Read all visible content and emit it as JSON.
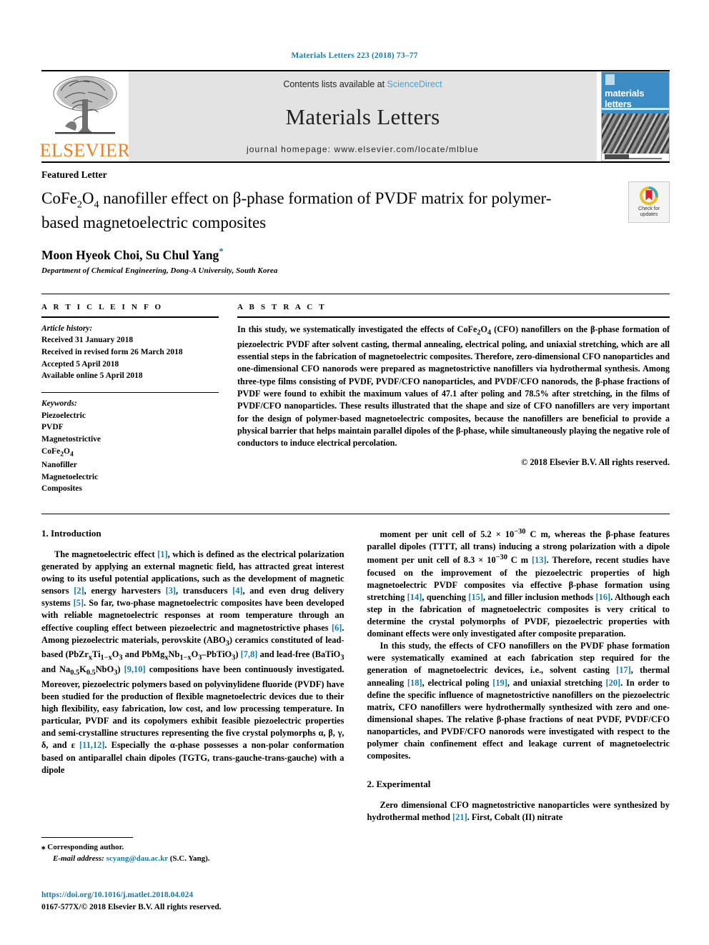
{
  "running_head": "Materials Letters 223 (2018) 73–77",
  "masthead": {
    "publisher_name": "ELSEVIER",
    "contents_prefix": "Contents lists available at ",
    "contents_link": "ScienceDirect",
    "journal_title": "Materials Letters",
    "homepage": "journal homepage: www.elsevier.com/locate/mlblue",
    "cover_title": "materials letters",
    "link_color": "#3aa6d8",
    "brand_color": "#ef7d22"
  },
  "article": {
    "type_label": "Featured Letter",
    "title_html": "CoFe<sub>2</sub>O<sub>4</sub> nanofiller effect on β-phase formation of PVDF matrix for polymer-based magnetoelectric composites",
    "title_plain": "CoFe2O4 nanofiller effect on β-phase formation of PVDF matrix for polymer-based magnetoelectric composites",
    "authors": "Moon Hyeok Choi, Su Chul Yang",
    "corresponding_marker": "*",
    "affiliation": "Department of Chemical Engineering, Dong-A University, South Korea",
    "crossmark_line1": "Check for",
    "crossmark_line2": "updates"
  },
  "article_info": {
    "heading": "A R T I C L E  I N F O",
    "history_label": "Article history:",
    "history": [
      "Received 31 January 2018",
      "Received in revised form 26 March 2018",
      "Accepted 5 April 2018",
      "Available online 5 April 2018"
    ],
    "keywords_label": "Keywords:",
    "keywords": [
      "Piezoelectric",
      "PVDF",
      "Magnetostrictive",
      "CoFe2O4",
      "Nanofiller",
      "Magnetoelectric",
      "Composites"
    ]
  },
  "abstract": {
    "heading": "A B S T R A C T",
    "text_html": "In this study, we systematically investigated the effects of CoFe<sub>2</sub>O<sub>4</sub> (CFO) nanofillers on the β-phase formation of piezoelectric PVDF after solvent casting, thermal annealing, electrical poling, and uniaxial stretching, which are all essential steps in the fabrication of magnetoelectric composites. Therefore, zero-dimensional CFO nanoparticles and one-dimensional CFO nanorods were prepared as magnetostrictive nanofillers via hydrothermal synthesis. Among three-type films consisting of PVDF, PVDF/CFO nanoparticles, and PVDF/CFO nanorods, the β-phase fractions of PVDF were found to exhibit the maximum values of 47.1 after poling and 78.5% after stretching, in the films of PVDF/CFO nanoparticles. These results illustrated that the shape and size of CFO nanofillers are very important for the design of polymer-based magnetoelectric composites, because the nanofillers are beneficial to provide a physical barrier that helps maintain parallel dipoles of the β-phase, while simultaneously playing the negative role of conductors to induce electrical percolation.",
    "copyright": "© 2018 Elsevier B.V. All rights reserved."
  },
  "sections": {
    "introduction_heading": "1. Introduction",
    "experimental_heading": "2. Experimental",
    "intro_p1_html": "The magnetoelectric effect <span class=\"ref\">[1]</span>, which is defined as the electrical polarization generated by applying an external magnetic field, has attracted great interest owing to its useful potential applications, such as the development of magnetic sensors <span class=\"ref\">[2]</span>, energy harvesters <span class=\"ref\">[3]</span>, transducers <span class=\"ref\">[4]</span>, and even drug delivery systems <span class=\"ref\">[5]</span>. So far, two-phase magnetoelectric composites have been developed with reliable magnetoelectric responses at room temperature through an effective coupling effect between piezoelectric and magnetostrictive phases <span class=\"ref\">[6]</span>. Among piezoelectric materials, perovskite (ABO<sub>3</sub>) ceramics constituted of lead-based (PbZr<sub>x</sub>Ti<sub>1−x</sub>O<sub>3</sub> and PbMg<sub>x</sub>Nb<sub>1−x</sub>O<sub>3</sub>–PbTiO<sub>3</sub>) <span class=\"ref\">[7,8]</span> and lead-free (BaTiO<sub>3</sub> and Na<sub>0.5</sub>K<sub>0.5</sub>NbO<sub>3</sub>) <span class=\"ref\">[9,10]</span> compositions have been continuously investigated. Moreover, piezoelectric polymers based on polyvinylidene fluoride (PVDF) have been studied for the production of flexible magnetoelectric devices due to their high flexibility, easy fabrication, low cost, and low processing temperature. In particular, PVDF and its copolymers exhibit feasible piezoelectric properties and semi-crystalline structures representing the five crystal polymorphs α, β, γ, δ, and ε <span class=\"ref\">[11,12]</span>. Especially the α-phase possesses a non-polar conformation based on antiparallel chain dipoles (TGTG, trans-gauche-trans-gauche) with a dipole",
    "intro_p2_html": "moment per unit cell of 5.2 × 10<sup>−30</sup> C m, whereas the β-phase features parallel dipoles (TTTT, all trans) inducing a strong polarization with a dipole moment per unit cell of 8.3 × 10<sup>−30</sup> C m <span class=\"ref\">[13]</span>. Therefore, recent studies have focused on the improvement of the piezoelectric properties of high magnetoelectric PVDF composites via effective β-phase formation using stretching <span class=\"ref\">[14]</span>, quenching <span class=\"ref\">[15]</span>, and filler inclusion methods <span class=\"ref\">[16]</span>. Although each step in the fabrication of magnetoelectric composites is very critical to determine the crystal polymorphs of PVDF, piezoelectric properties with dominant effects were only investigated after composite preparation.",
    "intro_p3_html": "In this study, the effects of CFO nanofillers on the PVDF phase formation were systematically examined at each fabrication step required for the generation of magnetoelectric devices, i.e., solvent casting <span class=\"ref\">[17]</span>, thermal annealing <span class=\"ref\">[18]</span>, electrical poling <span class=\"ref\">[19]</span>, and uniaxial stretching <span class=\"ref\">[20]</span>. In order to define the specific influence of magnetostrictive nanofillers on the piezoelectric matrix, CFO nanofillers were hydrothermally synthesized with zero and one-dimensional shapes. The relative β-phase fractions of neat PVDF, PVDF/CFO nanoparticles, and PVDF/CFO nanorods were investigated with respect to the polymer chain confinement effect and leakage current of magnetoelectric composites.",
    "experimental_p1_html": "Zero dimensional CFO magnetostrictive nanoparticles were synthesized by hydrothermal method <span class=\"ref\">[21]</span>. First, Cobalt (II) nitrate"
  },
  "footnote": {
    "marker": "⁎",
    "corresponding": "Corresponding author.",
    "email_label": "E-mail address:",
    "email": "scyang@dau.ac.kr",
    "email_suffix": "(S.C. Yang).",
    "doi": "https://doi.org/10.1016/j.matlet.2018.04.024",
    "issn_line": "0167-577X/© 2018 Elsevier B.V. All rights reserved."
  }
}
